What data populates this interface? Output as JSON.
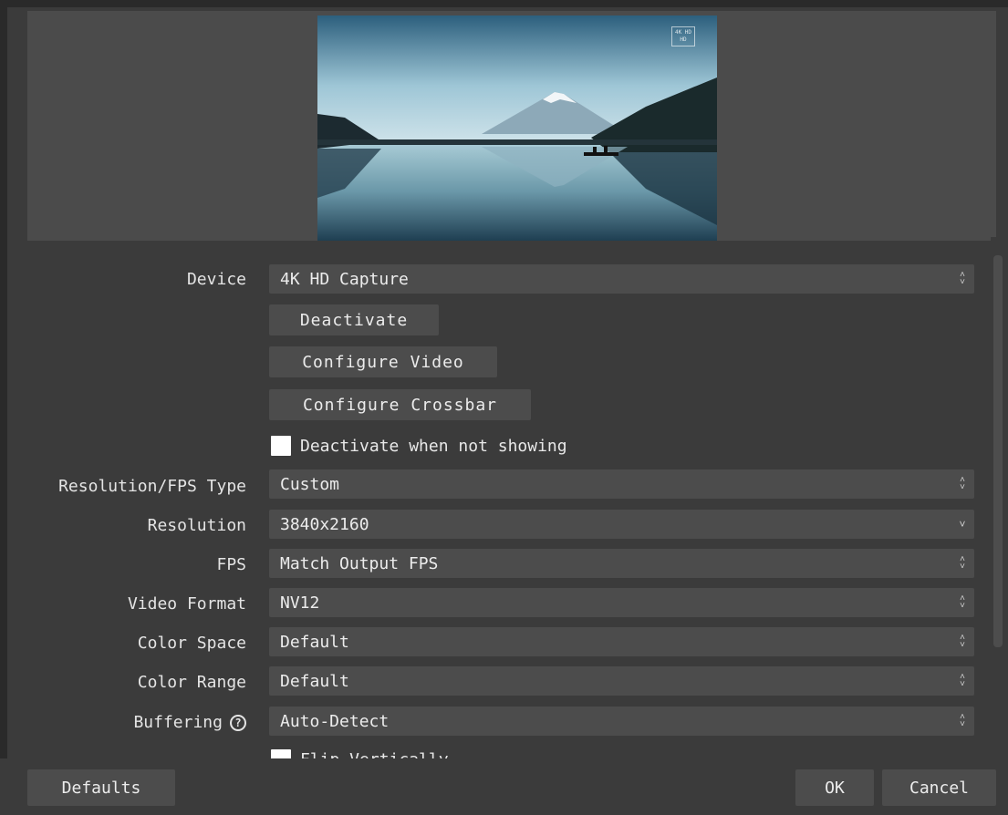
{
  "preview": {
    "watermark_line1": "4K HD",
    "watermark_line2": "HD"
  },
  "properties": {
    "device": {
      "label": "Device",
      "value": "4K HD Capture"
    },
    "deactivate_button": "Deactivate",
    "configure_video_button": "Configure Video",
    "configure_crossbar_button": "Configure Crossbar",
    "deactivate_when_not_showing": {
      "label": "Deactivate when not showing",
      "checked": false
    },
    "resolution_fps_type": {
      "label": "Resolution/FPS Type",
      "value": "Custom"
    },
    "resolution": {
      "label": "Resolution",
      "value": "3840x2160"
    },
    "fps": {
      "label": "FPS",
      "value": "Match Output FPS"
    },
    "video_format": {
      "label": "Video Format",
      "value": "NV12"
    },
    "color_space": {
      "label": "Color Space",
      "value": "Default"
    },
    "color_range": {
      "label": "Color Range",
      "value": "Default"
    },
    "buffering": {
      "label": "Buffering",
      "value": "Auto-Detect",
      "help_glyph": "?"
    },
    "flip_vertically": {
      "label": "Flip Vertically",
      "checked": false
    }
  },
  "footer": {
    "defaults_button": "Defaults",
    "ok_button": "OK",
    "cancel_button": "Cancel"
  },
  "icons": {
    "updown": "up-down-chevron-icon",
    "down": "chevron-down-icon"
  },
  "colors": {
    "background": "#3b3b3b",
    "control": "#4c4c4c",
    "text": "#ececec"
  }
}
